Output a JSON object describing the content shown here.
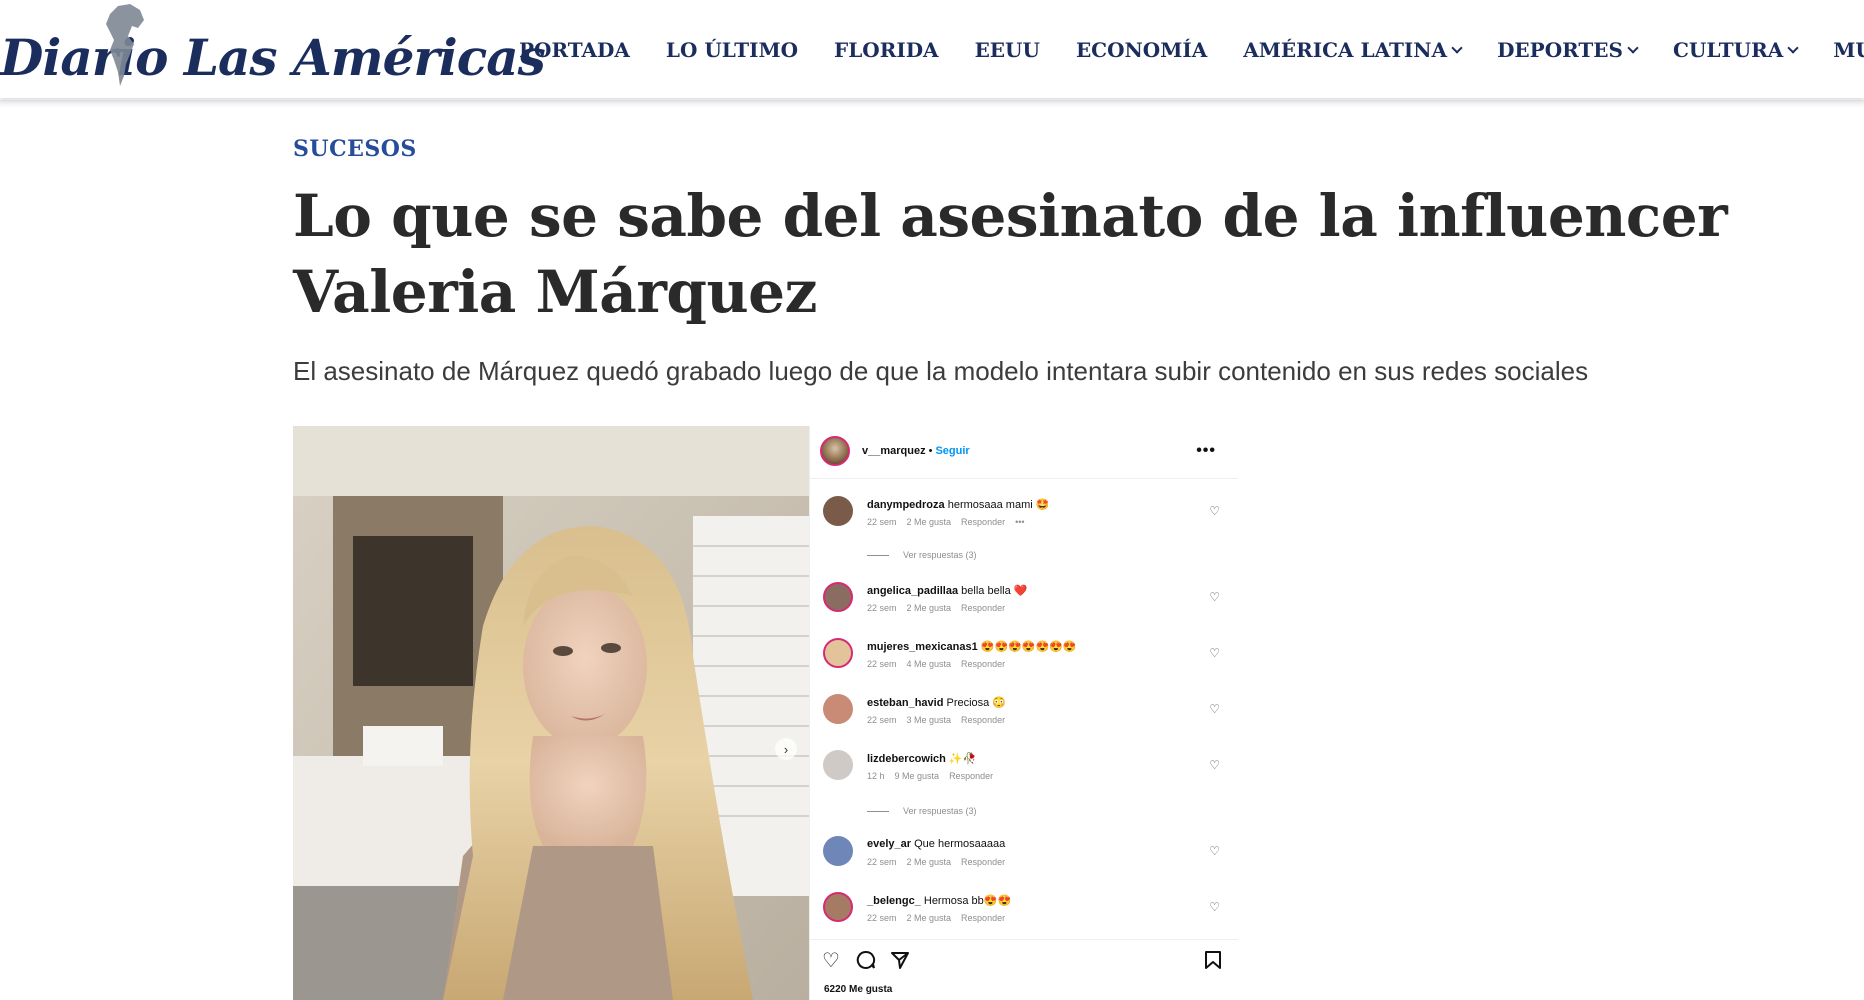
{
  "header": {
    "logo_text": "Diario Las Américas",
    "nav": [
      {
        "label": "PORTADA",
        "dropdown": false
      },
      {
        "label": "LO ÚLTIMO",
        "dropdown": false
      },
      {
        "label": "FLORIDA",
        "dropdown": false
      },
      {
        "label": "EEUU",
        "dropdown": false
      },
      {
        "label": "ECONOMÍA",
        "dropdown": false
      },
      {
        "label": "AMÉRICA LATINA",
        "dropdown": true
      },
      {
        "label": "DEPORTES",
        "dropdown": true
      },
      {
        "label": "CULTURA",
        "dropdown": true
      },
      {
        "label": "MUNDO",
        "dropdown": false
      }
    ]
  },
  "article": {
    "category": "SUCESOS",
    "headline": "Lo que se sabe del asesinato de la influencer Valeria Márquez",
    "subtitle": "El asesinato de Márquez quedó grabado luego de que la modelo intentara subir contenido en sus redes sociales"
  },
  "instagram": {
    "username": "v__marquez",
    "dot": "•",
    "follow_label": "Seguir",
    "more": "•••",
    "comments": [
      {
        "user": "danympedroza",
        "text": "hermosaaa mami 🤩",
        "time": "22 sem",
        "likes": "2 Me gusta",
        "reply": "Responder",
        "extra": "•••"
      },
      {
        "user": "angelica_padillaa",
        "text": "bella bella ❤️",
        "time": "22 sem",
        "likes": "2 Me gusta",
        "reply": "Responder"
      },
      {
        "user": "mujeres_mexicanas1",
        "text": "😍😍😍😍😍😍😍",
        "time": "22 sem",
        "likes": "4 Me gusta",
        "reply": "Responder"
      },
      {
        "user": "esteban_havid",
        "text": "Preciosa 😳",
        "time": "22 sem",
        "likes": "3 Me gusta",
        "reply": "Responder"
      },
      {
        "user": "lizdebercowich",
        "text": "✨🥀",
        "time": "12 h",
        "likes": "9 Me gusta",
        "reply": "Responder"
      },
      {
        "user": "evely_ar",
        "text": "Que hermosaaaaa",
        "time": "22 sem",
        "likes": "2 Me gusta",
        "reply": "Responder"
      },
      {
        "user": "_belengc_",
        "text": "Hermosa bb😍😍",
        "time": "22 sem",
        "likes": "2 Me gusta",
        "reply": "Responder"
      }
    ],
    "view_replies": "Ver respuestas (3)",
    "likes_total": "6220 Me gusta"
  },
  "icons": [
    "globe-logo-icon",
    "chevron-down-icon",
    "heart-icon",
    "comment-icon",
    "share-icon",
    "bookmark-icon",
    "next-arrow-icon"
  ],
  "colors": {
    "brand_navy": "#1b2d5c",
    "category_blue": "#264c9a",
    "ig_follow_blue": "#0095f6"
  }
}
